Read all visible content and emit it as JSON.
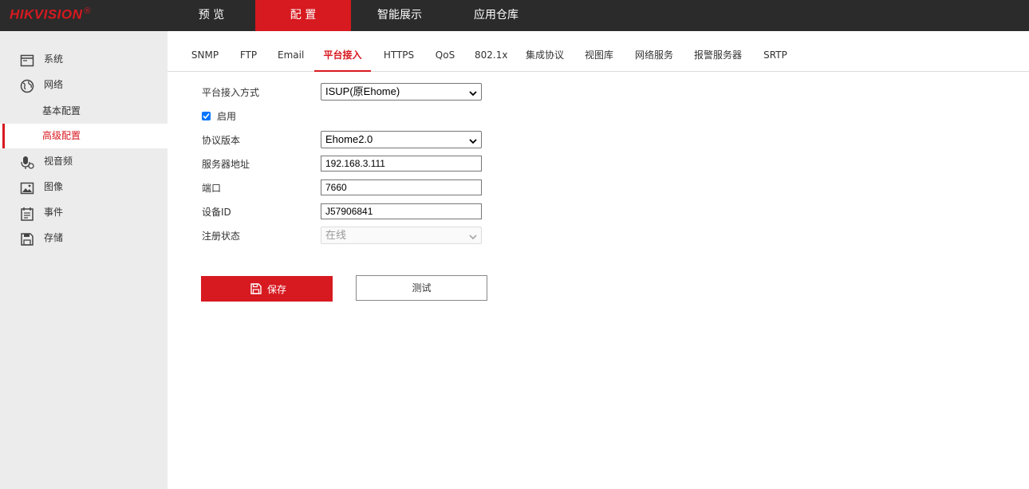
{
  "brand": {
    "name": "HIKVISION",
    "mark": "®"
  },
  "topnav": [
    {
      "label": "预 览"
    },
    {
      "label": "配 置"
    },
    {
      "label": "智能展示"
    },
    {
      "label": "应用仓库"
    }
  ],
  "sidebar": {
    "items": [
      {
        "label": "系统",
        "icon": "system-icon"
      },
      {
        "label": "网络",
        "icon": "globe-icon"
      },
      {
        "label": "视音频",
        "icon": "microphone-icon"
      },
      {
        "label": "图像",
        "icon": "image-icon"
      },
      {
        "label": "事件",
        "icon": "calendar-icon"
      },
      {
        "label": "存储",
        "icon": "floppy-disk-icon"
      }
    ],
    "network_sub": [
      {
        "label": "基本配置"
      },
      {
        "label": "高级配置"
      }
    ]
  },
  "tabs": [
    {
      "label": "SNMP"
    },
    {
      "label": "FTP"
    },
    {
      "label": "Email"
    },
    {
      "label": "平台接入"
    },
    {
      "label": "HTTPS"
    },
    {
      "label": "QoS"
    },
    {
      "label": "802.1x"
    },
    {
      "label": "集成协议"
    },
    {
      "label": "视图库"
    },
    {
      "label": "网络服务"
    },
    {
      "label": "报警服务器"
    },
    {
      "label": "SRTP"
    }
  ],
  "form": {
    "access_mode": {
      "label": "平台接入方式",
      "value": "ISUP(原Ehome)"
    },
    "enable": {
      "label": "启用",
      "checked": true
    },
    "protocol_version": {
      "label": "协议版本",
      "value": "Ehome2.0"
    },
    "server_address": {
      "label": "服务器地址",
      "value": "192.168.3.111"
    },
    "port": {
      "label": "端口",
      "value": "7660"
    },
    "device_id": {
      "label": "设备ID",
      "value": "J57906841"
    },
    "register_status": {
      "label": "注册状态",
      "value": "在线"
    }
  },
  "buttons": {
    "save": "保存",
    "test": "测试"
  },
  "colors": {
    "accent": "#d71920",
    "topbar": "#2b2b2b",
    "sidebar": "#ececec",
    "checkbox": "#0075ff"
  }
}
